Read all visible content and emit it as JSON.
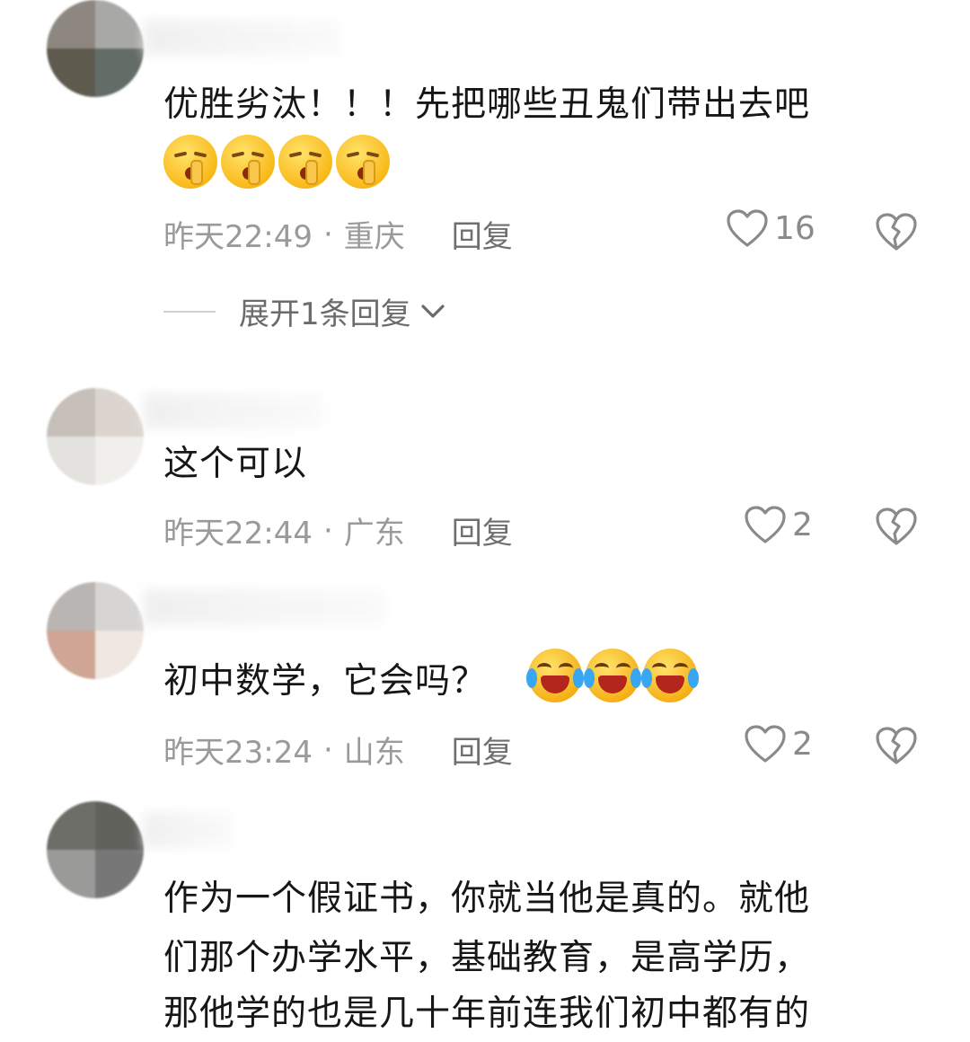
{
  "colors": {
    "meta_gray": "#9a9a9a",
    "text": "#161616",
    "reply": "#6f6f6f"
  },
  "comments": [
    {
      "text_lines": [
        "优胜劣汰！！！先把哪些丑鬼们带出去吧"
      ],
      "emojis": [
        "shh-emoji",
        "shh-emoji",
        "shh-emoji",
        "shh-emoji"
      ],
      "time": "昨天22:49",
      "sep": "·",
      "location": "重庆",
      "reply_label": "回复",
      "likes": "16"
    },
    {
      "text_lines": [
        "这个可以"
      ],
      "time": "昨天22:44",
      "sep": "·",
      "location": "广东",
      "reply_label": "回复",
      "likes": "2"
    },
    {
      "text_lines": [
        "初中数学，它会吗？"
      ],
      "emojis": [
        "laugh-cry-emoji",
        "laugh-cry-emoji",
        "laugh-cry-emoji"
      ],
      "time": "昨天23:24",
      "sep": "·",
      "location": "山东",
      "reply_label": "回复",
      "likes": "2"
    },
    {
      "text_lines": [
        "作为一个假证书，你就当他是真的。就他",
        "们那个办学水平，基础教育，是高学历，",
        "那他学的也是几十年前连我们初中都有的"
      ]
    }
  ],
  "expand_replies": {
    "label": "展开1条回复",
    "icon": "chevron-down-icon"
  }
}
